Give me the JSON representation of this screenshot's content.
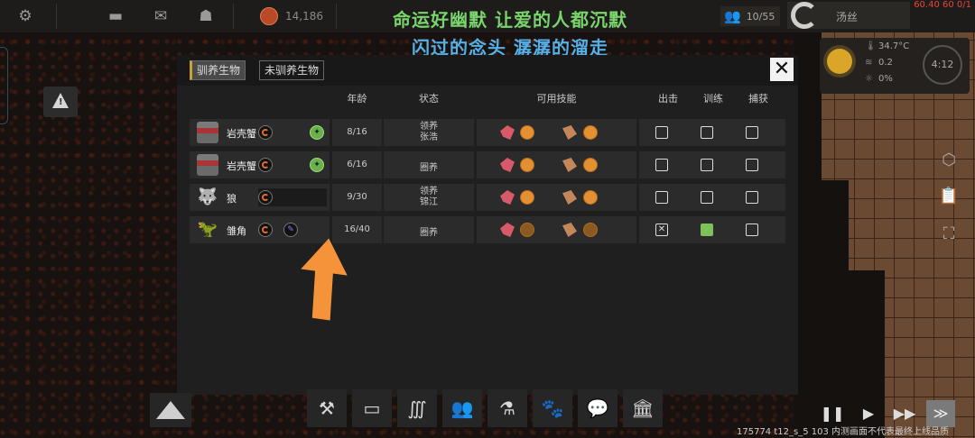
{
  "topbar": {
    "currency_value": "14,186",
    "population": "10/55",
    "player_name": "汤丝",
    "fps": "60.40 60 0/1"
  },
  "subtitles": {
    "line1": "命运好幽默 让爱的人都沉默",
    "line2": "闪过的念头 潺潺的溜走"
  },
  "weather": {
    "temperature": "34.7°C",
    "wind": "0.2",
    "rain": "0%",
    "time": "4:12"
  },
  "dialog": {
    "tabs": [
      "驯养生物",
      "未驯养生物"
    ],
    "close_label": "✕",
    "columns": {
      "age": "年龄",
      "status": "状态",
      "skills": "可用技能",
      "sortie": "出击",
      "train": "训练",
      "capture": "捕获"
    },
    "rows": [
      {
        "name": "岩壳蟹",
        "age": "8/16",
        "status": "领养\n张浩"
      },
      {
        "name": "岩壳蟹",
        "age": "6/16",
        "status": "圈养"
      },
      {
        "name": "狼",
        "age": "9/30",
        "status": "领养\n锦江"
      },
      {
        "name": "雏角",
        "age": "16/40",
        "status": "圈养"
      }
    ]
  },
  "footer": {
    "build_info": "175774 t12_s_5 103 内测画面不代表最终上线品质"
  },
  "colors": {
    "accent_gold": "#c9a03a",
    "arrow": "#f5933a",
    "check_green": "#7fc05a"
  }
}
